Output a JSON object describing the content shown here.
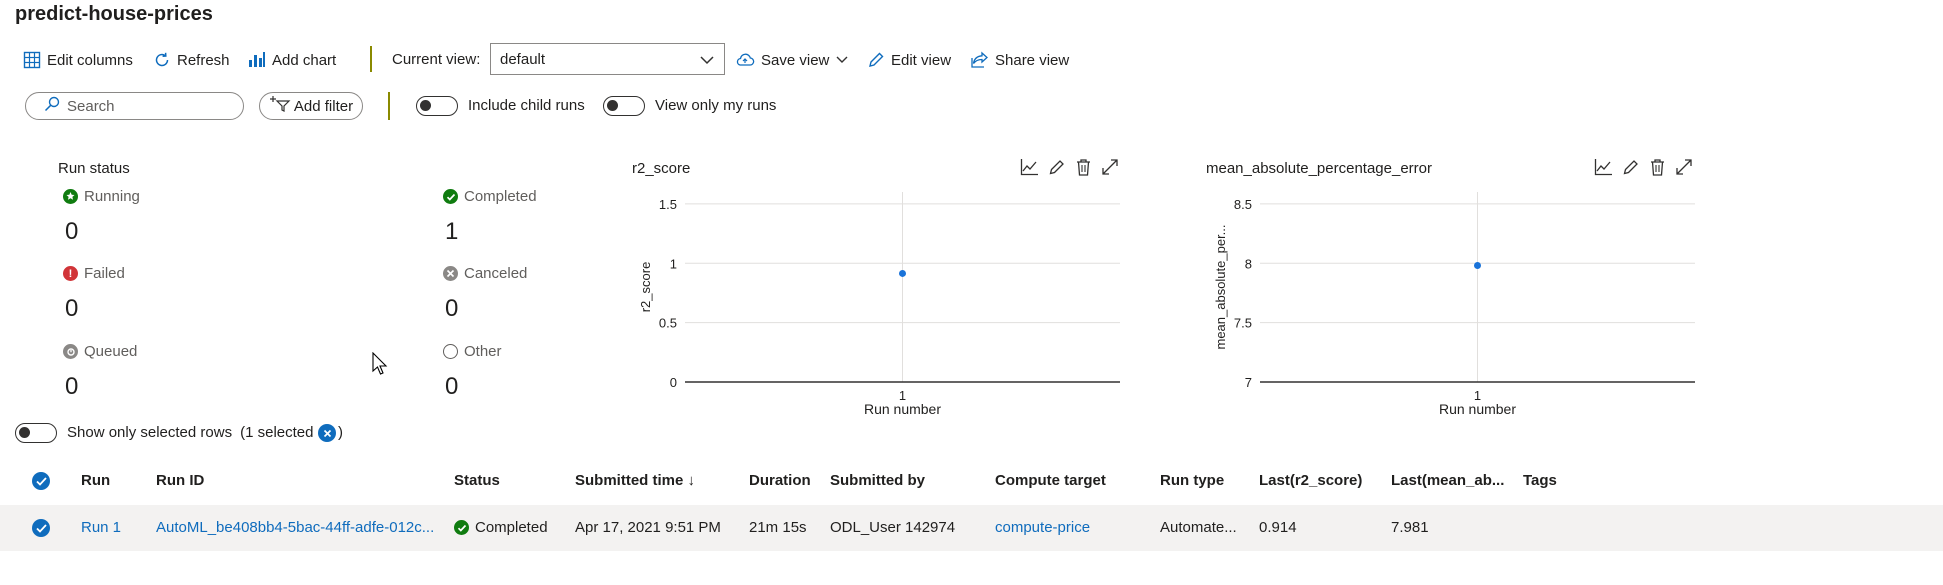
{
  "page": {
    "title": "predict-house-prices"
  },
  "toolbar": {
    "edit_columns": "Edit columns",
    "refresh": "Refresh",
    "add_chart": "Add chart",
    "current_view_label": "Current view:",
    "current_view_value": "default",
    "save_view": "Save view",
    "edit_view": "Edit view",
    "share_view": "Share view"
  },
  "filters": {
    "search_placeholder": "Search",
    "add_filter": "Add filter",
    "include_child_runs": "Include child runs",
    "view_only_my_runs": "View only my runs"
  },
  "run_status": {
    "title": "Run status",
    "items": [
      {
        "label": "Running",
        "value": "0",
        "color": "#107c10"
      },
      {
        "label": "Completed",
        "value": "1",
        "color": "#107c10"
      },
      {
        "label": "Failed",
        "value": "0",
        "color": "#d13438"
      },
      {
        "label": "Canceled",
        "value": "0",
        "color": "#8a8886"
      },
      {
        "label": "Queued",
        "value": "0",
        "color": "#8a8886"
      },
      {
        "label": "Other",
        "value": "0",
        "color": "#605e5c"
      }
    ]
  },
  "chart_data": [
    {
      "type": "scatter",
      "title": "r2_score",
      "xlabel": "Run number",
      "ylabel": "r2_score",
      "x_ticks": [
        "1"
      ],
      "y_ticks": [
        "0",
        "0.5",
        "1",
        "1.5"
      ],
      "ylim": [
        0,
        1.6
      ],
      "series": [
        {
          "x": [
            1
          ],
          "y": [
            0.914
          ]
        }
      ],
      "color": "#1a73d9"
    },
    {
      "type": "scatter",
      "title": "mean_absolute_percentage_error",
      "xlabel": "Run number",
      "ylabel": "mean_absolute_per...",
      "x_ticks": [
        "1"
      ],
      "y_ticks": [
        "7",
        "7.5",
        "8",
        "8.5"
      ],
      "ylim": [
        7,
        8.6
      ],
      "series": [
        {
          "x": [
            1
          ],
          "y": [
            7.981
          ]
        }
      ],
      "color": "#1a73d9"
    }
  ],
  "selection": {
    "toggle_label": "Show only selected rows",
    "count_label": "(1 selected",
    "count_close": ")"
  },
  "table": {
    "headers": [
      "Run",
      "Run ID",
      "Status",
      "Submitted time ↓",
      "Duration",
      "Submitted by",
      "Compute target",
      "Run type",
      "Last(r2_score)",
      "Last(mean_ab...",
      "Tags"
    ],
    "rows": [
      {
        "run": "Run 1",
        "run_id": "AutoML_be408bb4-5bac-44ff-adfe-012c...",
        "status": "Completed",
        "submitted_time": "Apr 17, 2021 9:51 PM",
        "duration": "21m 15s",
        "submitted_by": "ODL_User 142974",
        "compute_target": "compute-price",
        "run_type": "Automate...",
        "last_r2": "0.914",
        "last_mape": "7.981",
        "tags": ""
      }
    ]
  }
}
